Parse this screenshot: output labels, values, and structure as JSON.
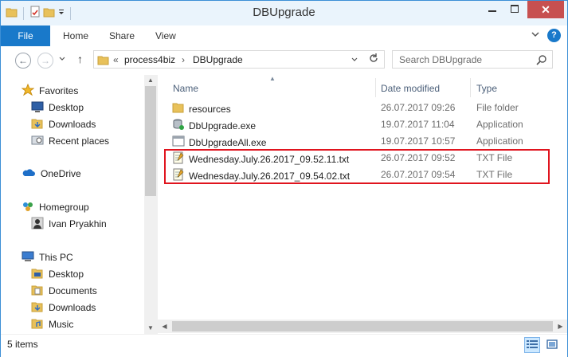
{
  "window": {
    "title": "DBUpgrade",
    "close_glyph": "✕",
    "minimize_glyph": "—",
    "maximize_glyph": "▭"
  },
  "ribbon": {
    "tabs": [
      "File",
      "Home",
      "Share",
      "View"
    ],
    "help_glyph": "?",
    "collapse_glyph": "⌄"
  },
  "nav": {
    "back_glyph": "←",
    "forward_glyph": "→",
    "up_glyph": "↑",
    "history_glyph": "⌄",
    "breadcrumb_overflow": "«",
    "breadcrumbs": [
      "process4biz",
      "DBUpgrade"
    ],
    "breadcrumb_sep": "›",
    "address_dropdown_glyph": "⌄"
  },
  "search": {
    "placeholder": "Search DBUpgrade"
  },
  "navpane": {
    "favorites": "Favorites",
    "favorites_items": [
      "Desktop",
      "Downloads",
      "Recent places"
    ],
    "onedrive": "OneDrive",
    "homegroup": "Homegroup",
    "homegroup_items": [
      "Ivan Pryakhin"
    ],
    "thispc": "This PC",
    "thispc_items": [
      "Desktop",
      "Documents",
      "Downloads",
      "Music"
    ]
  },
  "columns": {
    "name": "Name",
    "date": "Date modified",
    "type": "Type"
  },
  "files": [
    {
      "name": "resources",
      "date": "26.07.2017 09:26",
      "type": "File folder",
      "icon": "folder-icon"
    },
    {
      "name": "DbUpgrade.exe",
      "date": "19.07.2017 11:04",
      "type": "Application",
      "icon": "application-icon"
    },
    {
      "name": "DbUpgradeAll.exe",
      "date": "19.07.2017 10:57",
      "type": "Application",
      "icon": "application-icon"
    },
    {
      "name": "Wednesday.July.26.2017_09.52.11.txt",
      "date": "26.07.2017 09:52",
      "type": "TXT File",
      "icon": "text-file-icon"
    },
    {
      "name": "Wednesday.July.26.2017_09.54.02.txt",
      "date": "26.07.2017 09:54",
      "type": "TXT File",
      "icon": "text-file-icon"
    }
  ],
  "status": {
    "count": "5 items"
  },
  "colors": {
    "accent": "#1979ca",
    "highlight": "#e0141e",
    "folder": "#e8c15a"
  }
}
